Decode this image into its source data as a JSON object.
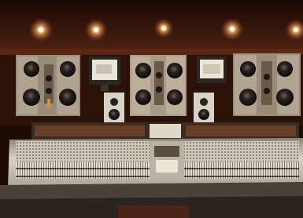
{
  "photo": {
    "subject": "recording-studio-control-room",
    "colors": {
      "wall": "#2a1208",
      "ceiling": "#3a1a0c",
      "speaker_panel": "#a89a88",
      "woofer": "#1a1614",
      "console": "#d8d2c8",
      "console_shadow": "#6a6258",
      "desk": "#3a3530",
      "light": "#ffd8a0"
    },
    "monitors": 2,
    "ceiling_lights": 5
  }
}
